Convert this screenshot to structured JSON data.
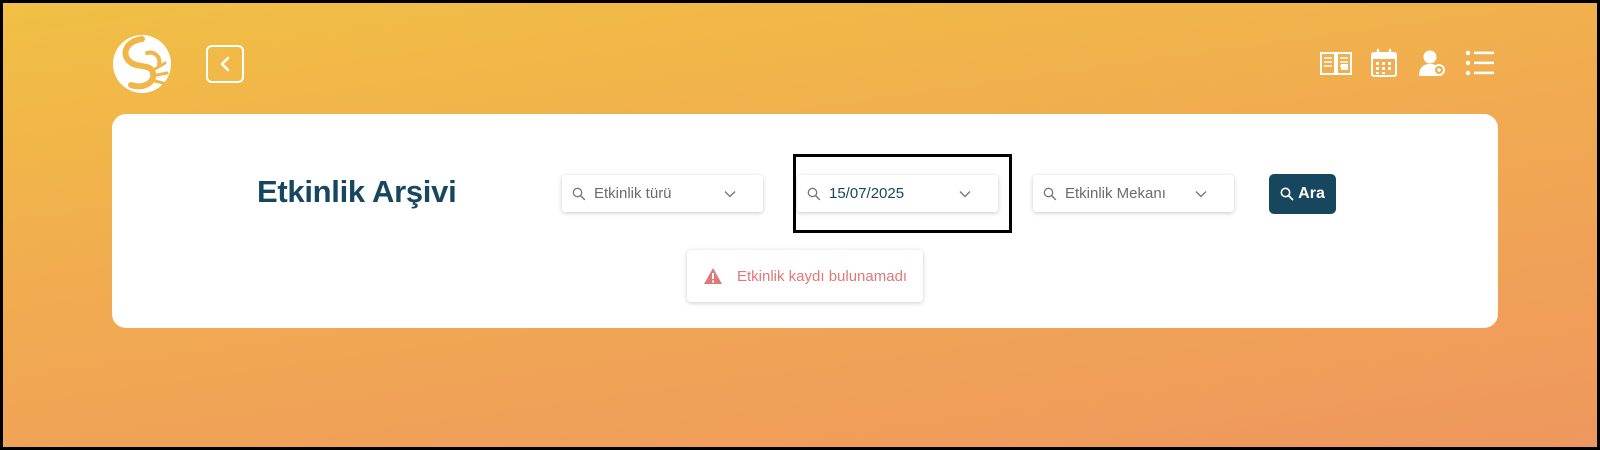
{
  "header": {
    "logo_icon": "s-leaf-logo-icon",
    "back_icon": "chevron-left-icon",
    "icons": [
      "book-icon",
      "calendar-icon",
      "user-icon",
      "menu-list-icon"
    ]
  },
  "main": {
    "title": "Etkinlik Arşivi",
    "filters": {
      "type_placeholder": "Etkinlik türü",
      "date_value": "15/07/2025",
      "venue_placeholder": "Etkinlik Mekanı"
    },
    "search_label": "Ara",
    "alert_text": "Etkinlik kaydı bulunamadı"
  },
  "colors": {
    "primary": "#17475f",
    "alert": "#e0787a",
    "bg_top": "#f1c044",
    "bg_bottom": "#ef975f"
  }
}
